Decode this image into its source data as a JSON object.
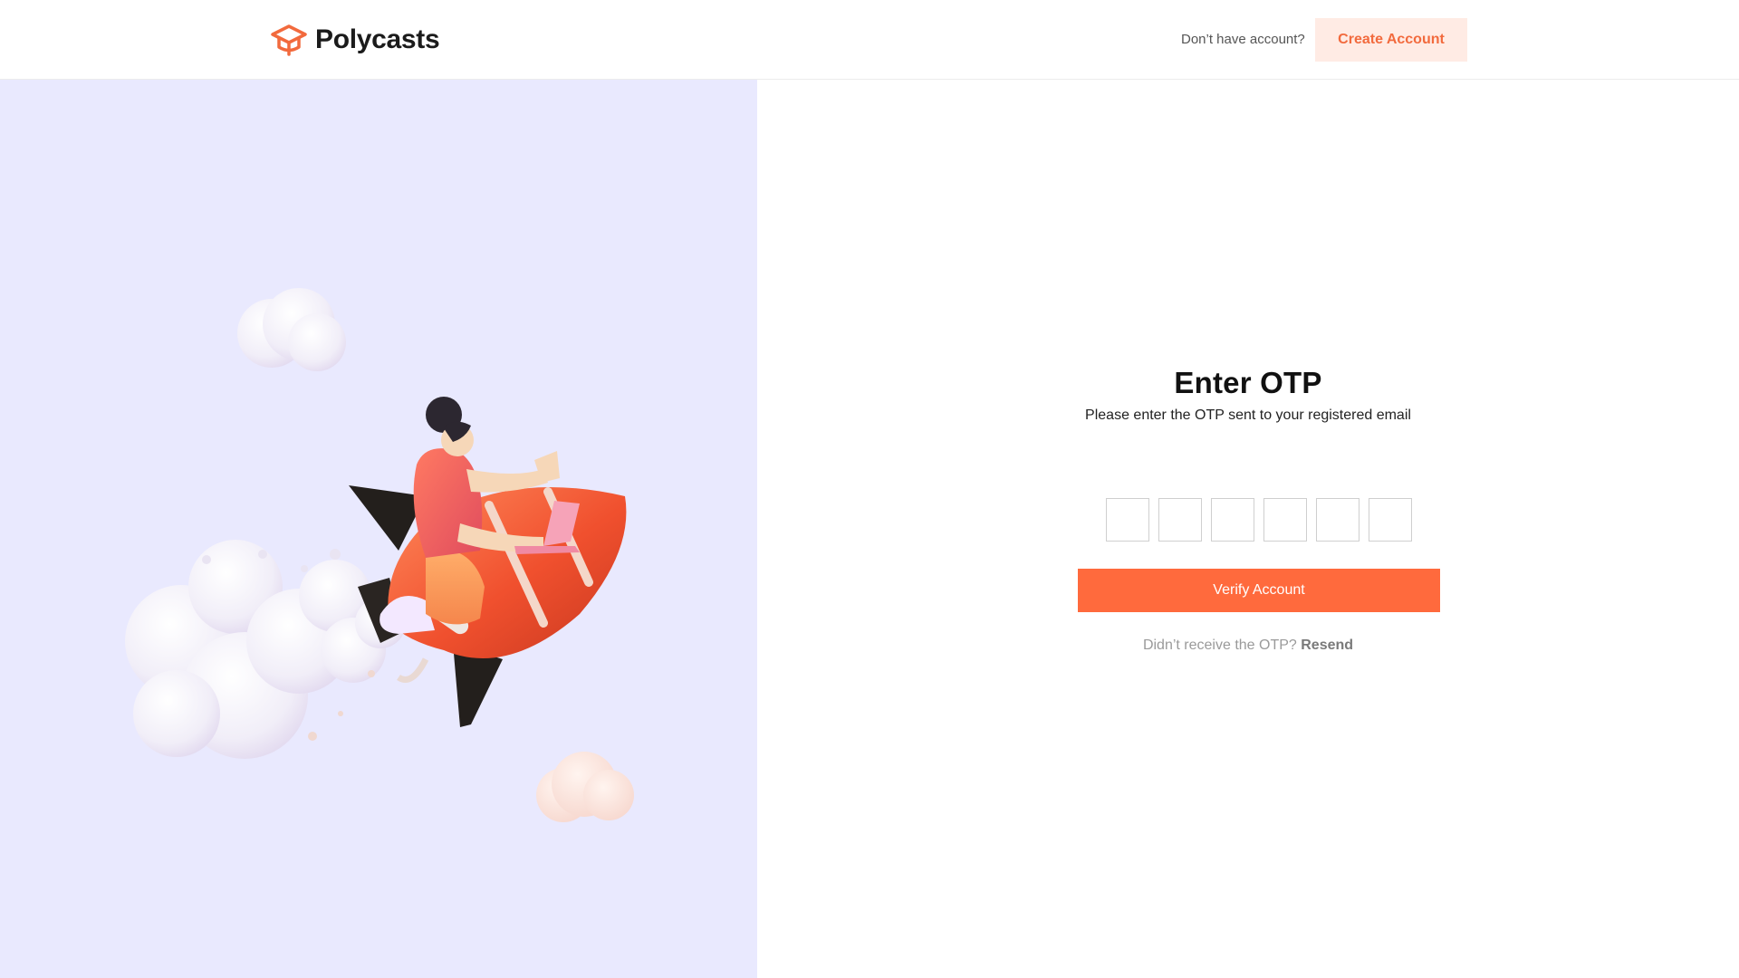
{
  "header": {
    "brand": "Polycasts",
    "prompt": "Don’t have account?",
    "create_label": "Create Account"
  },
  "otp": {
    "title": "Enter OTP",
    "subtitle": "Please enter the OTP sent to your registered email",
    "digits": [
      "",
      "",
      "",
      "",
      "",
      ""
    ],
    "verify_label": "Verify Account",
    "resend_prompt": "Didn’t receive the OTP?",
    "resend_label": "Resend"
  },
  "colors": {
    "accent": "#ff6a3d",
    "accent_soft": "#ffebe4",
    "left_panel_bg": "#e9e9fe"
  },
  "icons": {
    "logo": "graduation-cap-icon"
  }
}
